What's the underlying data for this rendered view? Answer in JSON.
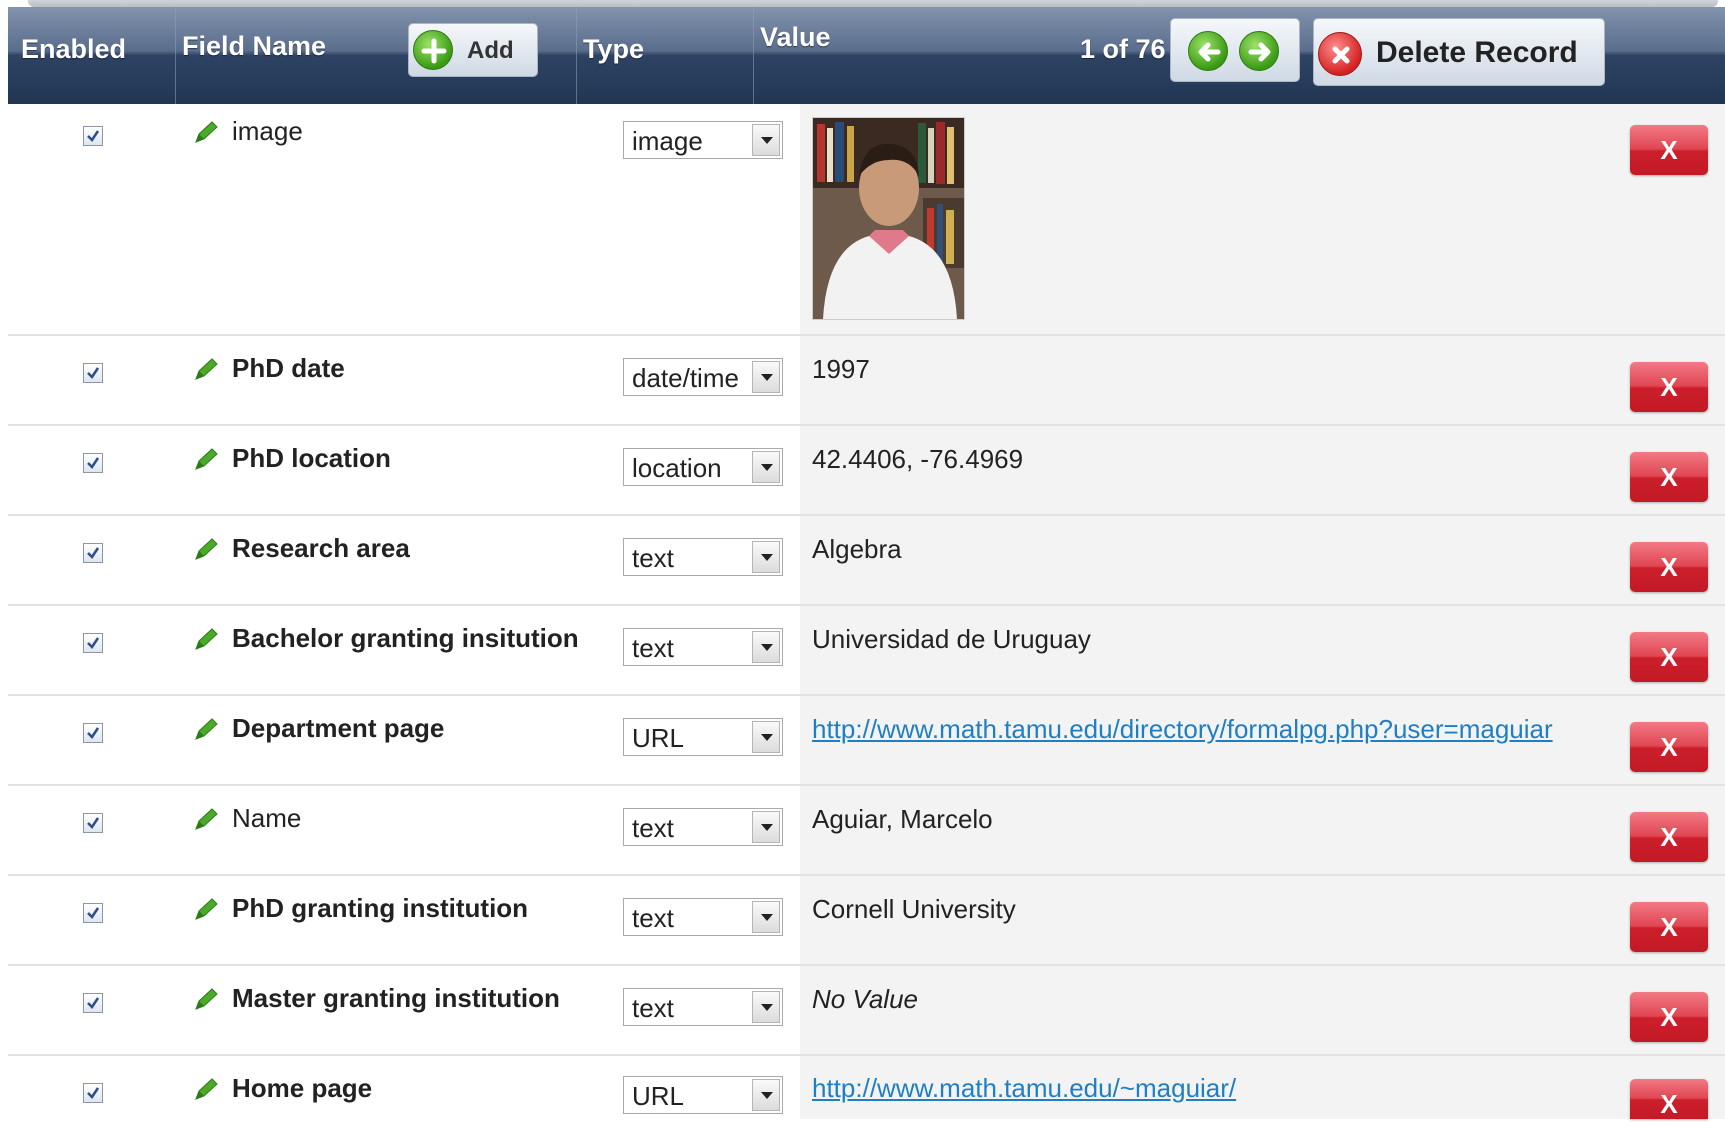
{
  "header": {
    "enabled_label": "Enabled",
    "field_name_label": "Field Name",
    "add_label": "Add",
    "type_label": "Type",
    "value_label": "Value",
    "pager": "1 of 76",
    "delete_record_label": "Delete Record"
  },
  "rows": [
    {
      "field": "image",
      "type": "image",
      "value": "",
      "enabled": true,
      "delete": "X"
    },
    {
      "field": "PhD date",
      "type": "date/time",
      "value": "1997",
      "enabled": true,
      "delete": "X"
    },
    {
      "field": "PhD location",
      "type": "location",
      "value": "42.4406, -76.4969",
      "enabled": true,
      "delete": "X"
    },
    {
      "field": "Research area",
      "type": "text",
      "value": "Algebra",
      "enabled": true,
      "delete": "X"
    },
    {
      "field": "Bachelor granting insitution",
      "type": "text",
      "value": "Universidad de Uruguay",
      "enabled": true,
      "delete": "X"
    },
    {
      "field": "Department page",
      "type": "URL",
      "value": "http://www.math.tamu.edu/directory/formalpg.php?user=maguiar",
      "enabled": true,
      "delete": "X"
    },
    {
      "field": "Name",
      "type": "text",
      "value": "Aguiar, Marcelo",
      "enabled": true,
      "delete": "X"
    },
    {
      "field": "PhD granting institution",
      "type": "text",
      "value": "Cornell University",
      "enabled": true,
      "delete": "X"
    },
    {
      "field": "Master granting institution",
      "type": "text",
      "value": "No Value",
      "enabled": true,
      "delete": "X"
    },
    {
      "field": "Home page",
      "type": "URL",
      "value": "http://www.math.tamu.edu/~maguiar/",
      "enabled": true,
      "delete": "X"
    }
  ],
  "colors": {
    "header_dark": "#223654",
    "link": "#1f7fc4",
    "delete_red": "#cc1f2b",
    "value_bg": "#f3f3f3"
  }
}
